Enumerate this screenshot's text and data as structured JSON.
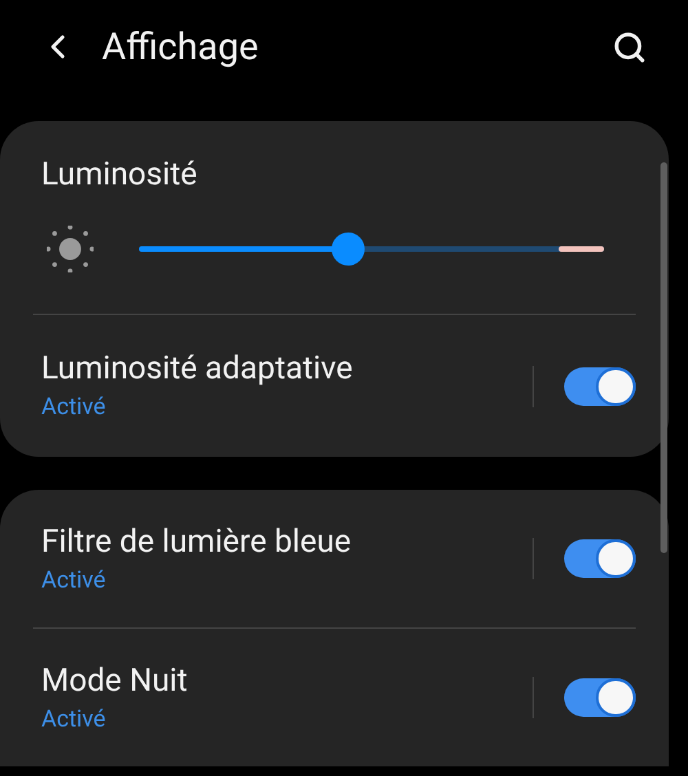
{
  "header": {
    "title": "Affichage"
  },
  "brightness": {
    "title": "Luminosité",
    "level": 0.45
  },
  "groups": [
    {
      "items": [
        {
          "label": "Luminosité adaptative",
          "status": "Activé",
          "on": true
        }
      ]
    },
    {
      "items": [
        {
          "label": "Filtre de lumière bleue",
          "status": "Activé",
          "on": true
        },
        {
          "label": "Mode Nuit",
          "status": "Activé",
          "on": true
        }
      ]
    }
  ]
}
